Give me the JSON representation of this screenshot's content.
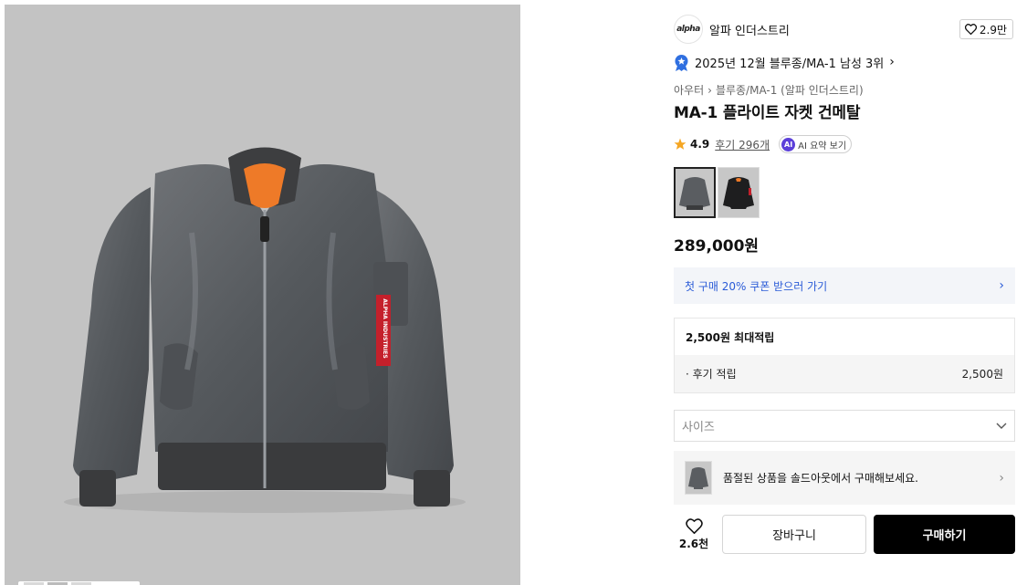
{
  "brand": {
    "logo_text": "alpha",
    "name": "알파 인더스트리",
    "likes": "2.9만"
  },
  "ranking": {
    "text": "2025년 12월 블루종/MA-1 남성 3위"
  },
  "breadcrumb": {
    "category": "아우터",
    "subcategory": "블루종/MA-1 (알파 인더스트리)"
  },
  "product": {
    "title": "MA-1 플라이트 자켓 건메탈",
    "rating": "4.9",
    "reviews": "후기 296개",
    "ai_summary": "AI 요약 보기",
    "ai_badge": "AI",
    "price": "289,000원",
    "image_text": "ALPHA INDUSTRIES"
  },
  "swatches": [
    {
      "color": "건메탈",
      "selected": true
    },
    {
      "color": "블랙",
      "selected": false
    }
  ],
  "coupon": {
    "text": "첫 구매 20% 쿠폰 받으러 가기"
  },
  "points": {
    "max_label": "2,500원 최대적립",
    "review_label": "· 후기 적립",
    "review_value": "2,500원"
  },
  "size": {
    "placeholder": "사이즈"
  },
  "soldout": {
    "text": "품절된 상품을 솔드아웃에서 구매해보세요."
  },
  "actions": {
    "wish_count": "2.6천",
    "cart_label": "장바구니",
    "buy_label": "구매하기"
  },
  "colors": {
    "accent_blue": "#2a5bd7",
    "buy_button": "#000000",
    "ai_badge": "#5b3fd9",
    "star": "#f5a623"
  }
}
